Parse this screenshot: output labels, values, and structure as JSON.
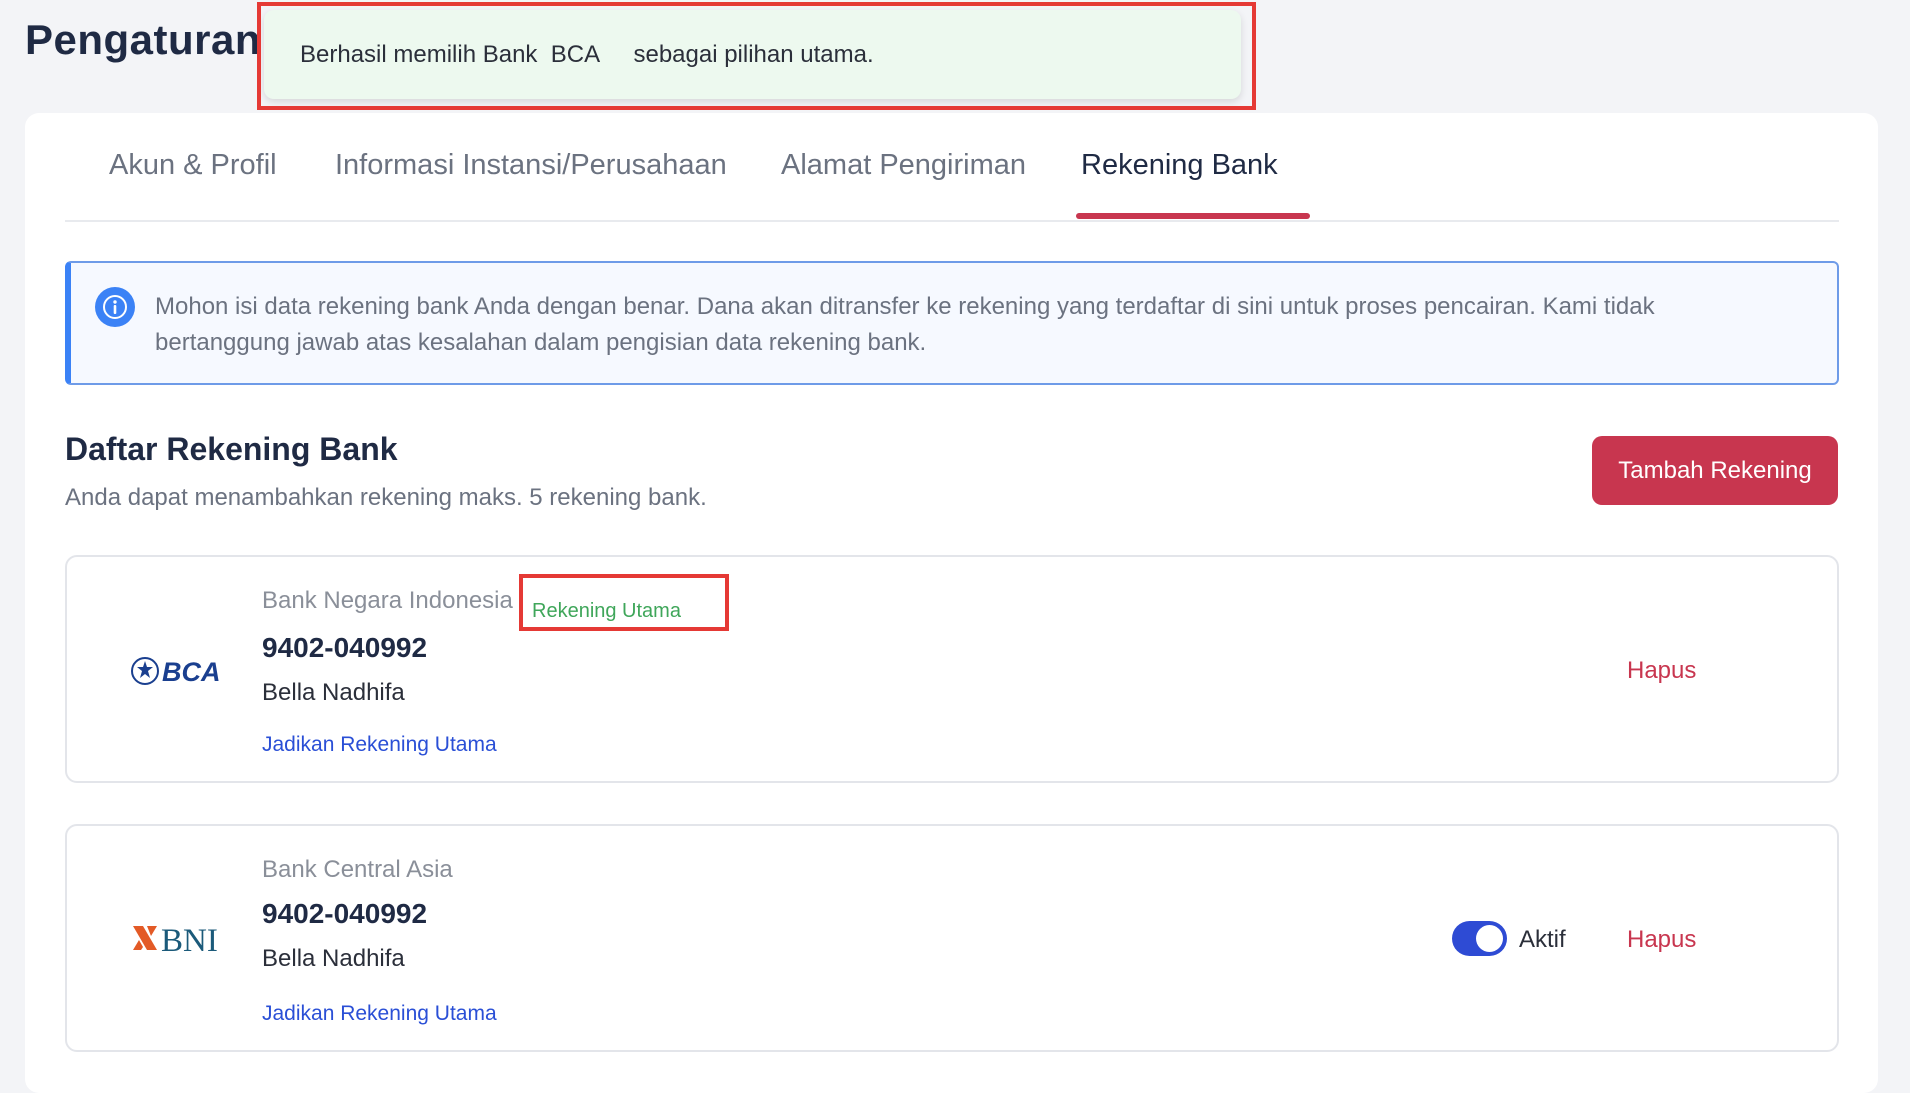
{
  "page": {
    "title": "Pengaturan"
  },
  "toast": {
    "prefix": "Berhasil memilih Bank  ",
    "bank": "BCA",
    "suffix": "     sebagai pilihan utama."
  },
  "tabs": [
    {
      "label": "Akun & Profil"
    },
    {
      "label": "Informasi Instansi/Perusahaan"
    },
    {
      "label": "Alamat Pengiriman"
    },
    {
      "label": "Rekening Bank",
      "active": true
    }
  ],
  "info": {
    "line1": "Mohon isi data rekening bank Anda dengan benar. Dana akan ditransfer ke rekening yang terdaftar di sini untuk proses pencairan. Kami tidak",
    "line2": "bertanggung jawab atas kesalahan dalam pengisian data rekening bank."
  },
  "section": {
    "title": "Daftar Rekening Bank",
    "subtitle": "Anda dapat menambahkan rekening maks. 5 rekening bank.",
    "add_button": "Tambah Rekening"
  },
  "accounts": [
    {
      "logo": "BCA",
      "bank_name": "Bank Negara Indonesia",
      "badge": "Rekening Utama",
      "account_number": "9402-040992",
      "holder": "Bella Nadhifa",
      "make_primary": "Jadikan Rekening Utama",
      "delete": "Hapus"
    },
    {
      "logo": "BNI",
      "bank_name": "Bank Central Asia",
      "account_number": "9402-040992",
      "holder": "Bella Nadhifa",
      "make_primary": "Jadikan Rekening Utama",
      "toggle_label": "Aktif",
      "toggle_on": true,
      "delete": "Hapus"
    }
  ],
  "colors": {
    "brand": "#c8364f",
    "link": "#2a4fd6",
    "success": "#3fa65a",
    "info": "#3b82f6",
    "toggle": "#2e4bd4"
  }
}
